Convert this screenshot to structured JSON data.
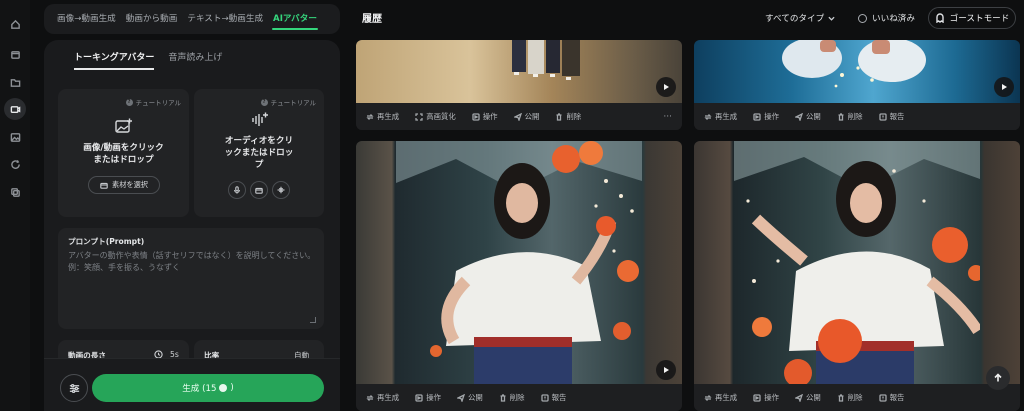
{
  "colors": {
    "accent": "#35d67d",
    "generate": "#26a559",
    "panel": "#1a1b1d",
    "card": "#222325"
  },
  "rail": {
    "icons": [
      "home-icon",
      "box-icon",
      "folder-icon",
      "video-avatar-icon",
      "image-icon",
      "refresh-icon",
      "layers-icon"
    ]
  },
  "modes": [
    "画像→動画生成",
    "動画から動画",
    "テキスト→動画生成",
    "AIアバター"
  ],
  "subtabs": [
    "トーキングアバター",
    "音声読み上げ"
  ],
  "image_card": {
    "tutorial": "チュートリアル",
    "title_line1": "画像/動画をクリック",
    "title_line2": "またはドロップ",
    "select_label": "素材を選択"
  },
  "audio_card": {
    "tutorial": "チュートリアル",
    "title_line1": "オーディオをクリ",
    "title_line2": "ックまたはドロッ",
    "title_line3": "プ"
  },
  "prompt": {
    "label": "プロンプト(Prompt)",
    "placeholder": "アバターの動作や表情（話すセリフではなく）を説明してください。例：笑顔、手を振る、うなずく"
  },
  "duration": {
    "label": "動画の長さ",
    "value": "5s"
  },
  "ratio": {
    "label": "比率",
    "value": "自動"
  },
  "generate": {
    "label_prefix": "生成 (15",
    "label_suffix": ")"
  },
  "header": {
    "title": "履歴",
    "type_filter": "すべてのタイプ",
    "liked": "いいね済み",
    "ghost": "ゴーストモード"
  },
  "actions": {
    "regen": "再生成",
    "upscale": "高画質化",
    "operate": "操作",
    "publish": "公開",
    "delete": "削除",
    "report": "報告",
    "more": "···"
  }
}
